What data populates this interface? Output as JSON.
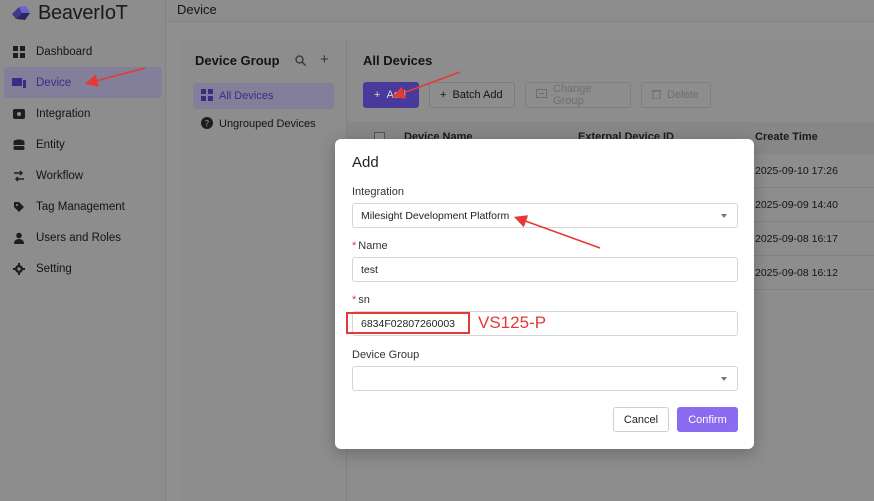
{
  "app": {
    "name": "BeaverIoT",
    "page_title": "Device"
  },
  "sidebar": {
    "items": [
      {
        "label": "Dashboard",
        "icon": "dashboard-icon",
        "active": false
      },
      {
        "label": "Device",
        "icon": "device-icon",
        "active": true
      },
      {
        "label": "Integration",
        "icon": "integration-icon",
        "active": false
      },
      {
        "label": "Entity",
        "icon": "entity-icon",
        "active": false
      },
      {
        "label": "Workflow",
        "icon": "workflow-icon",
        "active": false
      },
      {
        "label": "Tag Management",
        "icon": "tag-icon",
        "active": false
      },
      {
        "label": "Users and Roles",
        "icon": "user-icon",
        "active": false
      },
      {
        "label": "Setting",
        "icon": "gear-icon",
        "active": false
      }
    ]
  },
  "device_group": {
    "title": "Device Group",
    "items": [
      {
        "label": "All Devices",
        "active": true
      },
      {
        "label": "Ungrouped Devices",
        "active": false
      }
    ]
  },
  "all_devices": {
    "title": "All Devices",
    "toolbar": {
      "add": "Add",
      "batch_add": "Batch Add",
      "change_group": "Change Group",
      "delete": "Delete"
    },
    "columns": {
      "device_name": "Device Name",
      "external_id": "External Device ID",
      "create_time": "Create Time"
    },
    "rows": [
      {
        "create_time": "2025-09-10 17:26"
      },
      {
        "create_time": "2025-09-09 14:40"
      },
      {
        "create_time": "2025-09-08 16:17"
      },
      {
        "create_time": "2025-09-08 16:12"
      }
    ]
  },
  "modal": {
    "title": "Add",
    "integration_label": "Integration",
    "integration_value": "Milesight Development Platform",
    "name_label": "Name",
    "name_value": "test",
    "sn_label": "sn",
    "sn_value": "6834F02807260003",
    "group_label": "Device Group",
    "group_value": "",
    "required_mark": "*",
    "cancel": "Cancel",
    "confirm": "Confirm"
  },
  "annotation": {
    "text": "VS125-P",
    "color": "#e53935"
  },
  "colors": {
    "accent": "#8b6cf0",
    "annotation": "#e53935"
  }
}
